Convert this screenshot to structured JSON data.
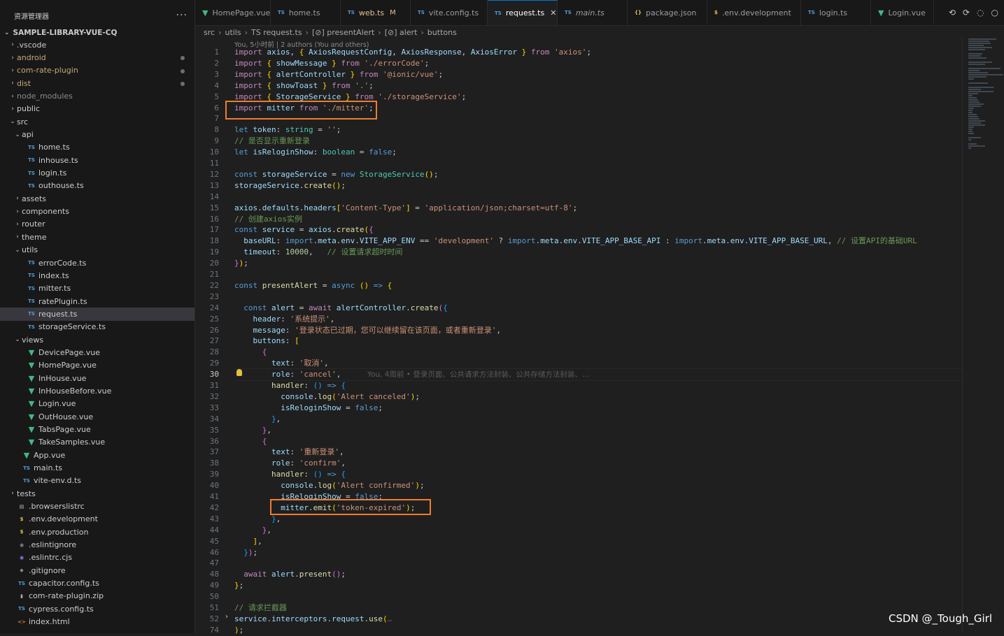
{
  "sidebar": {
    "title": "资源管理器",
    "more": "···",
    "root": "SAMPLE-LIBRARY-VUE-CQ",
    "items": [
      {
        "label": ".vscode",
        "twisty": "›",
        "icon": "",
        "indent": 0,
        "kind": "folder"
      },
      {
        "label": "android",
        "twisty": "›",
        "icon": "",
        "indent": 0,
        "kind": "folder-mod"
      },
      {
        "label": "com-rate-plugin",
        "twisty": "›",
        "icon": "",
        "indent": 0,
        "kind": "folder-mod"
      },
      {
        "label": "dist",
        "twisty": "›",
        "icon": "",
        "indent": 0,
        "kind": "folder-mod"
      },
      {
        "label": "node_modules",
        "twisty": "›",
        "icon": "",
        "indent": 0,
        "kind": "folder-dim"
      },
      {
        "label": "public",
        "twisty": "›",
        "icon": "",
        "indent": 0,
        "kind": "folder"
      },
      {
        "label": "src",
        "twisty": "⌄",
        "icon": "",
        "indent": 0,
        "kind": "folder"
      },
      {
        "label": "api",
        "twisty": "⌄",
        "icon": "",
        "indent": 1,
        "kind": "folder"
      },
      {
        "label": "home.ts",
        "twisty": "",
        "icon": "TS",
        "indent": 2,
        "kind": "ts"
      },
      {
        "label": "inhouse.ts",
        "twisty": "",
        "icon": "TS",
        "indent": 2,
        "kind": "ts"
      },
      {
        "label": "login.ts",
        "twisty": "",
        "icon": "TS",
        "indent": 2,
        "kind": "ts"
      },
      {
        "label": "outhouse.ts",
        "twisty": "",
        "icon": "TS",
        "indent": 2,
        "kind": "ts"
      },
      {
        "label": "assets",
        "twisty": "›",
        "icon": "",
        "indent": 1,
        "kind": "folder"
      },
      {
        "label": "components",
        "twisty": "›",
        "icon": "",
        "indent": 1,
        "kind": "folder"
      },
      {
        "label": "router",
        "twisty": "›",
        "icon": "",
        "indent": 1,
        "kind": "folder"
      },
      {
        "label": "theme",
        "twisty": "›",
        "icon": "",
        "indent": 1,
        "kind": "folder"
      },
      {
        "label": "utils",
        "twisty": "⌄",
        "icon": "",
        "indent": 1,
        "kind": "folder"
      },
      {
        "label": "errorCode.ts",
        "twisty": "",
        "icon": "TS",
        "indent": 2,
        "kind": "ts"
      },
      {
        "label": "index.ts",
        "twisty": "",
        "icon": "TS",
        "indent": 2,
        "kind": "ts"
      },
      {
        "label": "mitter.ts",
        "twisty": "",
        "icon": "TS",
        "indent": 2,
        "kind": "ts"
      },
      {
        "label": "ratePlugin.ts",
        "twisty": "",
        "icon": "TS",
        "indent": 2,
        "kind": "ts"
      },
      {
        "label": "request.ts",
        "twisty": "",
        "icon": "TS",
        "indent": 2,
        "kind": "ts",
        "selected": true
      },
      {
        "label": "storageService.ts",
        "twisty": "",
        "icon": "TS",
        "indent": 2,
        "kind": "ts"
      },
      {
        "label": "views",
        "twisty": "⌄",
        "icon": "",
        "indent": 1,
        "kind": "folder"
      },
      {
        "label": "DevicePage.vue",
        "twisty": "",
        "icon": "▼",
        "indent": 2,
        "kind": "vue"
      },
      {
        "label": "HomePage.vue",
        "twisty": "",
        "icon": "▼",
        "indent": 2,
        "kind": "vue"
      },
      {
        "label": "InHouse.vue",
        "twisty": "",
        "icon": "▼",
        "indent": 2,
        "kind": "vue"
      },
      {
        "label": "InHouseBefore.vue",
        "twisty": "",
        "icon": "▼",
        "indent": 2,
        "kind": "vue"
      },
      {
        "label": "Login.vue",
        "twisty": "",
        "icon": "▼",
        "indent": 2,
        "kind": "vue"
      },
      {
        "label": "OutHouse.vue",
        "twisty": "",
        "icon": "▼",
        "indent": 2,
        "kind": "vue"
      },
      {
        "label": "TabsPage.vue",
        "twisty": "",
        "icon": "▼",
        "indent": 2,
        "kind": "vue"
      },
      {
        "label": "TakeSamples.vue",
        "twisty": "",
        "icon": "▼",
        "indent": 2,
        "kind": "vue"
      },
      {
        "label": "App.vue",
        "twisty": "",
        "icon": "▼",
        "indent": 1,
        "kind": "vue"
      },
      {
        "label": "main.ts",
        "twisty": "",
        "icon": "TS",
        "indent": 1,
        "kind": "ts"
      },
      {
        "label": "vite-env.d.ts",
        "twisty": "",
        "icon": "TS",
        "indent": 1,
        "kind": "ts"
      },
      {
        "label": "tests",
        "twisty": "›",
        "icon": "",
        "indent": 0,
        "kind": "folder"
      },
      {
        "label": ".browserslistrc",
        "twisty": "",
        "icon": "▤",
        "indent": 0,
        "kind": "gen"
      },
      {
        "label": ".env.development",
        "twisty": "",
        "icon": "$",
        "indent": 0,
        "kind": "env"
      },
      {
        "label": ".env.production",
        "twisty": "",
        "icon": "$",
        "indent": 0,
        "kind": "env"
      },
      {
        "label": ".eslintignore",
        "twisty": "",
        "icon": "◉",
        "indent": 0,
        "kind": "git"
      },
      {
        "label": ".eslintrc.cjs",
        "twisty": "",
        "icon": "◉",
        "indent": 0,
        "kind": "es"
      },
      {
        "label": ".gitignore",
        "twisty": "",
        "icon": "◆",
        "indent": 0,
        "kind": "git"
      },
      {
        "label": "capacitor.config.ts",
        "twisty": "",
        "icon": "TS",
        "indent": 0,
        "kind": "ts"
      },
      {
        "label": "com-rate-plugin.zip",
        "twisty": "",
        "icon": "▮",
        "indent": 0,
        "kind": "zip"
      },
      {
        "label": "cypress.config.ts",
        "twisty": "",
        "icon": "TS",
        "indent": 0,
        "kind": "ts"
      },
      {
        "label": "index.html",
        "twisty": "",
        "icon": "<>",
        "indent": 0,
        "kind": "html"
      }
    ]
  },
  "tabs": [
    {
      "label": "HomePage.vue",
      "icon": "▼",
      "kind": "vue"
    },
    {
      "label": "home.ts",
      "icon": "TS",
      "kind": "ts"
    },
    {
      "label": "web.ts",
      "icon": "TS",
      "kind": "ts",
      "badge": "M"
    },
    {
      "label": "vite.config.ts",
      "icon": "TS",
      "kind": "ts"
    },
    {
      "label": "request.ts",
      "icon": "TS",
      "kind": "ts",
      "active": true,
      "close": "✕"
    },
    {
      "label": "main.ts",
      "icon": "TS",
      "kind": "ts"
    },
    {
      "label": "package.json",
      "icon": "{}",
      "kind": "env"
    },
    {
      "label": ".env.development",
      "icon": "$",
      "kind": "env"
    },
    {
      "label": "login.ts",
      "icon": "TS",
      "kind": "ts"
    },
    {
      "label": "Login.vue",
      "icon": "▼",
      "kind": "vue"
    }
  ],
  "breadcrumb": [
    "src",
    "utils",
    "TS request.ts",
    "[⊘] presentAlert",
    "[⊘] alert",
    "buttons"
  ],
  "blame_top": "You, 5小时前 | 2 authors (You and others)",
  "ghost_text": "You, 4周前 • 登录页面、公共请求方法封装、公共存储方法封装、…",
  "watermark": "CSDN @_Tough_Girl",
  "current_line": "30",
  "lines": [
    {
      "n": "1",
      "html": "<span class='kc'>import</span> <span class='v'>axios</span>, <span class='b'>{</span> <span class='v'>AxiosRequestConfig</span>, <span class='v'>AxiosResponse</span>, <span class='v'>AxiosError</span> <span class='b'>}</span> <span class='kc'>from</span> <span class='s'>'axios'</span>;"
    },
    {
      "n": "2",
      "html": "<span class='kc'>import</span> <span class='b'>{</span> <span class='v'>showMessage</span> <span class='b'>}</span> <span class='kc'>from</span> <span class='s'>'./errorCode'</span>;"
    },
    {
      "n": "3",
      "html": "<span class='kc'>import</span> <span class='b'>{</span> <span class='v'>alertController</span> <span class='b'>}</span> <span class='kc'>from</span> <span class='s'>'@ionic/vue'</span>;"
    },
    {
      "n": "4",
      "html": "<span class='kc'>import</span> <span class='b'>{</span> <span class='v'>showToast</span> <span class='b'>}</span> <span class='kc'>from</span> <span class='s'>'.'</span>;"
    },
    {
      "n": "5",
      "html": "<span class='kc'>import</span> <span class='b'>{</span> <span class='v'>StorageService</span> <span class='b'>}</span> <span class='kc'>from</span> <span class='s'>'./storageService'</span>;"
    },
    {
      "n": "6",
      "html": "<span class='kc'>import</span> <span class='v'>mitter</span> <span class='kc'>from</span> <span class='s'>'./mitter'</span>;"
    },
    {
      "n": "7",
      "html": ""
    },
    {
      "n": "8",
      "html": "<span class='k'>let</span> <span class='v'>token</span>: <span class='t'>string</span> = <span class='s'>''</span>;"
    },
    {
      "n": "9",
      "html": "<span class='c'>// 是否显示重新登录</span>"
    },
    {
      "n": "10",
      "html": "<span class='k'>let</span> <span class='v'>isReloginShow</span>: <span class='t'>boolean</span> = <span class='k'>false</span>;"
    },
    {
      "n": "11",
      "html": ""
    },
    {
      "n": "12",
      "html": "<span class='k'>const</span> <span class='v'>storageService</span> = <span class='k'>new</span> <span class='t'>StorageService</span><span class='b'>()</span>;"
    },
    {
      "n": "13",
      "html": "<span class='v'>storageService</span>.<span class='f'>create</span><span class='b'>()</span>;"
    },
    {
      "n": "14",
      "html": ""
    },
    {
      "n": "15",
      "html": "<span class='v'>axios</span>.<span class='v'>defaults</span>.<span class='v'>headers</span><span class='b'>[</span><span class='s'>'Content-Type'</span><span class='b'>]</span> = <span class='s'>'application/json;charset=utf-8'</span>;"
    },
    {
      "n": "16",
      "html": "<span class='c'>// 创建axios实例</span>"
    },
    {
      "n": "17",
      "html": "<span class='k'>const</span> <span class='v'>service</span> = <span class='v'>axios</span>.<span class='f'>create</span><span class='b'>(</span><span class='b2'>{</span>"
    },
    {
      "n": "18",
      "html": "  <span class='v'>baseURL</span>: <span class='k'>import</span>.<span class='v'>meta</span>.<span class='v'>env</span>.<span class='v'>VITE_APP_ENV</span> == <span class='s'>'development'</span> ? <span class='k'>import</span>.<span class='v'>meta</span>.<span class='v'>env</span>.<span class='v'>VITE_APP_BASE_API</span> : <span class='k'>import</span>.<span class='v'>meta</span>.<span class='v'>env</span>.<span class='v'>VITE_APP_BASE_URL</span>, <span class='c'>// 设置API的基础URL</span>"
    },
    {
      "n": "19",
      "html": "  <span class='v'>timeout</span>: <span class='n'>10000</span>,   <span class='c'>// 设置请求超时时间</span>"
    },
    {
      "n": "20",
      "html": "<span class='b2'>}</span><span class='b'>)</span>;"
    },
    {
      "n": "21",
      "html": ""
    },
    {
      "n": "22",
      "html": "<span class='k'>const</span> <span class='f'>presentAlert</span> = <span class='k'>async</span> <span class='b'>()</span> <span class='k'>=&gt;</span> <span class='b'>{</span>"
    },
    {
      "n": "23",
      "html": ""
    },
    {
      "n": "24",
      "html": "  <span class='k'>const</span> <span class='v'>alert</span> = <span class='kc'>await</span> <span class='v'>alertController</span>.<span class='f'>create</span><span class='b2'>(</span><span class='b3'>{</span>"
    },
    {
      "n": "25",
      "html": "    <span class='v'>header</span>: <span class='s'>'系统提示'</span>,"
    },
    {
      "n": "26",
      "html": "    <span class='v'>message</span>: <span class='s'>'登录状态已过期，您可以继续留在该页面，或者重新登录'</span>,"
    },
    {
      "n": "27",
      "html": "    <span class='v'>buttons</span>: <span class='b'>[</span>"
    },
    {
      "n": "28",
      "html": "      <span class='b2'>{</span>"
    },
    {
      "n": "29",
      "html": "        <span class='v'>text</span>: <span class='s'>'取消'</span>,"
    },
    {
      "n": "30",
      "html": "        <span class='v'>role</span>: <span class='s'>'cancel'</span>,"
    },
    {
      "n": "31",
      "html": "        <span class='f'>handler</span>: <span class='b3'>()</span> <span class='k'>=&gt;</span> <span class='b3'>{</span>"
    },
    {
      "n": "32",
      "html": "          <span class='v'>console</span>.<span class='f'>log</span><span class='b'>(</span><span class='s'>'Alert canceled'</span><span class='b'>)</span>;"
    },
    {
      "n": "33",
      "html": "          <span class='v'>isReloginShow</span> = <span class='k'>false</span>;"
    },
    {
      "n": "34",
      "html": "        <span class='b3'>}</span>,"
    },
    {
      "n": "35",
      "html": "      <span class='b2'>}</span>,"
    },
    {
      "n": "36",
      "html": "      <span class='b2'>{</span>"
    },
    {
      "n": "37",
      "html": "        <span class='v'>text</span>: <span class='s'>'重新登录'</span>,"
    },
    {
      "n": "38",
      "html": "        <span class='v'>role</span>: <span class='s'>'confirm'</span>,"
    },
    {
      "n": "39",
      "html": "        <span class='f'>handler</span>: <span class='b3'>()</span> <span class='k'>=&gt;</span> <span class='b3'>{</span>"
    },
    {
      "n": "40",
      "html": "          <span class='v'>console</span>.<span class='f'>log</span><span class='b'>(</span><span class='s'>'Alert confirmed'</span><span class='b'>)</span>;"
    },
    {
      "n": "41",
      "html": "          <span class='v'>isReloginShow</span> = <span class='k'>false</span>;"
    },
    {
      "n": "42",
      "html": "          <span class='v'>mitter</span>.<span class='f'>emit</span><span class='b'>(</span><span class='s'>'token-expired'</span><span class='b'>)</span>;"
    },
    {
      "n": "43",
      "html": "        <span class='b3'>}</span>,"
    },
    {
      "n": "44",
      "html": "      <span class='b2'>}</span>,"
    },
    {
      "n": "45",
      "html": "    <span class='b'>]</span>,"
    },
    {
      "n": "46",
      "html": "  <span class='b3'>}</span><span class='b2'>)</span>;"
    },
    {
      "n": "47",
      "html": ""
    },
    {
      "n": "48",
      "html": "  <span class='kc'>await</span> <span class='v'>alert</span>.<span class='f'>present</span><span class='b2'>()</span>;"
    },
    {
      "n": "49",
      "html": "<span class='b'>}</span>;"
    },
    {
      "n": "50",
      "html": ""
    },
    {
      "n": "51",
      "html": "<span class='c'>// 请求拦截器</span>"
    },
    {
      "n": "52",
      "html": "<span class='v'>service</span>.<span class='v'>interceptors</span>.<span class='v'>request</span>.<span class='f'>use</span><span class='b'>(</span><span class='ghost'>…</span>"
    },
    {
      "n": "74",
      "html": "<span class='b'>)</span>;"
    }
  ]
}
